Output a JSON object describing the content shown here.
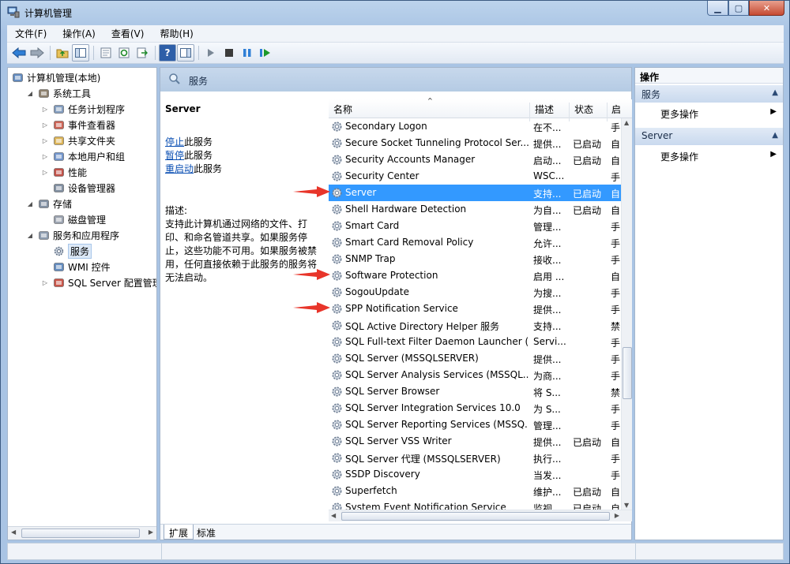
{
  "window": {
    "title": "计算机管理"
  },
  "menu": [
    "文件(F)",
    "操作(A)",
    "查看(V)",
    "帮助(H)"
  ],
  "tree": [
    {
      "label": "计算机管理(本地)",
      "indent": 0,
      "twist": "",
      "icon": "computer-icon"
    },
    {
      "label": "系统工具",
      "indent": 1,
      "twist": "◢",
      "icon": "tools-icon"
    },
    {
      "label": "任务计划程序",
      "indent": 2,
      "twist": "▷",
      "icon": "clock-icon"
    },
    {
      "label": "事件查看器",
      "indent": 2,
      "twist": "▷",
      "icon": "event-viewer-icon"
    },
    {
      "label": "共享文件夹",
      "indent": 2,
      "twist": "▷",
      "icon": "shared-folder-icon"
    },
    {
      "label": "本地用户和组",
      "indent": 2,
      "twist": "▷",
      "icon": "users-icon"
    },
    {
      "label": "性能",
      "indent": 2,
      "twist": "▷",
      "icon": "performance-icon"
    },
    {
      "label": "设备管理器",
      "indent": 2,
      "twist": "",
      "icon": "device-manager-icon"
    },
    {
      "label": "存储",
      "indent": 1,
      "twist": "◢",
      "icon": "storage-icon"
    },
    {
      "label": "磁盘管理",
      "indent": 2,
      "twist": "",
      "icon": "disk-icon"
    },
    {
      "label": "服务和应用程序",
      "indent": 1,
      "twist": "◢",
      "icon": "services-apps-icon"
    },
    {
      "label": "服务",
      "indent": 2,
      "twist": "",
      "icon": "gear-icon",
      "selected": true
    },
    {
      "label": "WMI 控件",
      "indent": 2,
      "twist": "",
      "icon": "wmi-icon"
    },
    {
      "label": "SQL Server 配置管理器",
      "indent": 2,
      "twist": "▷",
      "icon": "sql-config-icon"
    }
  ],
  "center": {
    "header_title": "服务",
    "selected_service": "Server",
    "actions": [
      {
        "link": "停止",
        "rest": "此服务"
      },
      {
        "link": "暂停",
        "rest": "此服务"
      },
      {
        "link": "重启动",
        "rest": "此服务"
      }
    ],
    "description_label": "描述:",
    "description": "支持此计算机通过网络的文件、打印、和命名管道共享。如果服务停止，这些功能不可用。如果服务被禁用，任何直接依赖于此服务的服务将无法启动。"
  },
  "columns": {
    "name": "名称",
    "desc": "描述",
    "status": "状态",
    "startup": "启"
  },
  "services": [
    {
      "name": "Secondary Logon",
      "desc": "在不...",
      "status": "",
      "startup": "手"
    },
    {
      "name": "Secure Socket Tunneling Protocol Ser...",
      "desc": "提供...",
      "status": "已启动",
      "startup": "自"
    },
    {
      "name": "Security Accounts Manager",
      "desc": "启动...",
      "status": "已启动",
      "startup": "自"
    },
    {
      "name": "Security Center",
      "desc": "WSC...",
      "status": "",
      "startup": "手"
    },
    {
      "name": "Server",
      "desc": "支持...",
      "status": "已启动",
      "startup": "自",
      "selected": true,
      "annotated": true
    },
    {
      "name": "Shell Hardware Detection",
      "desc": "为自...",
      "status": "已启动",
      "startup": "自"
    },
    {
      "name": "Smart Card",
      "desc": "管理...",
      "status": "",
      "startup": "手"
    },
    {
      "name": "Smart Card Removal Policy",
      "desc": "允许...",
      "status": "",
      "startup": "手"
    },
    {
      "name": "SNMP Trap",
      "desc": "接收...",
      "status": "",
      "startup": "手"
    },
    {
      "name": "Software Protection",
      "desc": "启用 ...",
      "status": "",
      "startup": "自",
      "annotated": true
    },
    {
      "name": "SogouUpdate",
      "desc": "为搜...",
      "status": "",
      "startup": "手"
    },
    {
      "name": "SPP Notification Service",
      "desc": "提供...",
      "status": "",
      "startup": "手",
      "annotated": true
    },
    {
      "name": "SQL Active Directory Helper 服务",
      "desc": "支持...",
      "status": "",
      "startup": "禁"
    },
    {
      "name": "SQL Full-text Filter Daemon Launcher (...",
      "desc": "Servi...",
      "status": "",
      "startup": "手"
    },
    {
      "name": "SQL Server (MSSQLSERVER)",
      "desc": "提供...",
      "status": "",
      "startup": "手"
    },
    {
      "name": "SQL Server Analysis Services (MSSQL...",
      "desc": "为商...",
      "status": "",
      "startup": "手"
    },
    {
      "name": "SQL Server Browser",
      "desc": "将 S...",
      "status": "",
      "startup": "禁"
    },
    {
      "name": "SQL Server Integration Services 10.0",
      "desc": "为 S...",
      "status": "",
      "startup": "手"
    },
    {
      "name": "SQL Server Reporting Services (MSSQ...",
      "desc": "管理...",
      "status": "",
      "startup": "手"
    },
    {
      "name": "SQL Server VSS Writer",
      "desc": "提供...",
      "status": "已启动",
      "startup": "自"
    },
    {
      "name": "SQL Server 代理 (MSSQLSERVER)",
      "desc": "执行...",
      "status": "",
      "startup": "手"
    },
    {
      "name": "SSDP Discovery",
      "desc": "当发...",
      "status": "",
      "startup": "手"
    },
    {
      "name": "Superfetch",
      "desc": "维护...",
      "status": "已启动",
      "startup": "自"
    },
    {
      "name": "System Event Notification Service",
      "desc": "监视...",
      "status": "已启动",
      "startup": "自"
    }
  ],
  "tabs": [
    "扩展",
    "标准"
  ],
  "actions_panel": {
    "title": "操作",
    "sections": [
      {
        "title": "服务",
        "item": "更多操作"
      },
      {
        "title": "Server",
        "item": "更多操作"
      }
    ]
  },
  "colors": {
    "selection": "#3399ff",
    "annotation_arrow": "#e8352a",
    "link": "#0b4fb3"
  }
}
